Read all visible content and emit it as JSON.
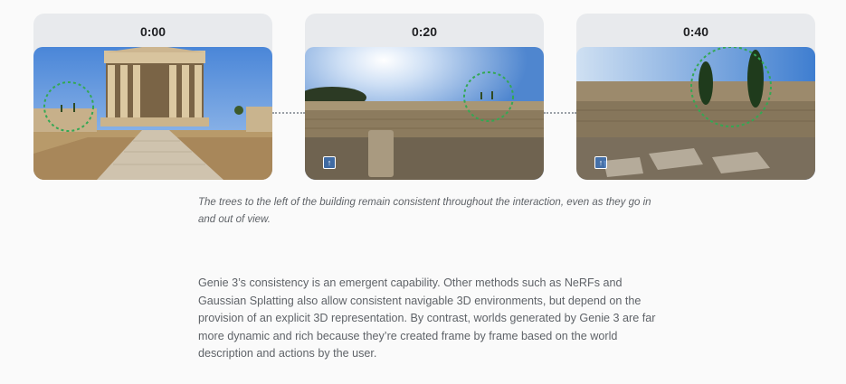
{
  "cards": [
    {
      "time": "0:00"
    },
    {
      "time": "0:20"
    },
    {
      "time": "0:40"
    }
  ],
  "caption": "The trees to the left of the building remain consistent throughout the interaction, even as they go in and out of view.",
  "body": "Genie 3’s consistency is an emergent capability. Other methods such as NeRFs and Gaussian Splatting also allow consistent navigable 3D environments, but depend on the provision of an explicit 3D representation. By contrast, worlds generated by Genie 3 are far more dynamic and rich because they’re created frame by frame based on the world description and actions by the user.",
  "colors": {
    "highlight_circle": "#34a853",
    "connector": "#9aa0a6"
  },
  "icons": {
    "frame_badge": "upload-icon"
  }
}
